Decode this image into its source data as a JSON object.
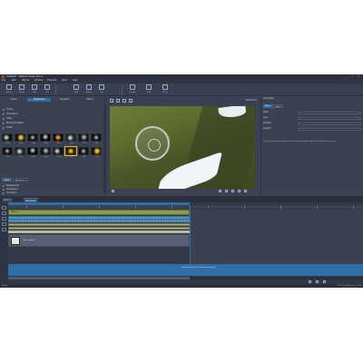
{
  "window": {
    "title": "Untitled* - MAGIX Video Pro X",
    "controls": "_ □ ×"
  },
  "menu": [
    "File",
    "Edit",
    "Effects",
    "Window",
    "Playback",
    "View",
    "Help"
  ],
  "toolbar": [
    "Import",
    "Export",
    "Edit",
    "Cut",
    "Split",
    "Delete",
    "Trim",
    "Render",
    "Burn",
    "Share"
  ],
  "left_tabs": [
    "Project",
    "Media Pool",
    "Templates",
    "Effects"
  ],
  "tree": [
    "Import",
    "Transitions",
    "Titles",
    "Movie templates",
    "Audio"
  ],
  "thumbs": [
    "Fade",
    "Blend",
    "Light",
    "Flare",
    "Burst",
    "Glow",
    "Flash",
    "Star",
    "Sun",
    "Ray",
    "Spark",
    "Beam",
    "Circle",
    "Disc",
    "Halo",
    "Lens"
  ],
  "sections": [
    "Basic",
    "Advanced"
  ],
  "list2": [
    "Backgrounds",
    "Decorations",
    "Intro/Outro"
  ],
  "preview": {
    "timecode": "00:00:04:12"
  },
  "right": {
    "head": "Properties",
    "tab": "Effect",
    "tab2": "Object",
    "props": [
      "Name",
      "Type",
      "Duration",
      "Position"
    ],
    "desc": "Drag the effect onto an object in the timeline to apply it. Adjust the settings in this panel."
  },
  "timeline": {
    "tabs": [
      "Movie 1",
      "Storyboard"
    ],
    "clip_video": "Video 1",
    "title_clip": "Title template",
    "hint": "Drag media files here to add them to the project"
  },
  "status": {
    "left": "Ready",
    "right": "CPU: 12%  Memory: 2.1 GB"
  }
}
